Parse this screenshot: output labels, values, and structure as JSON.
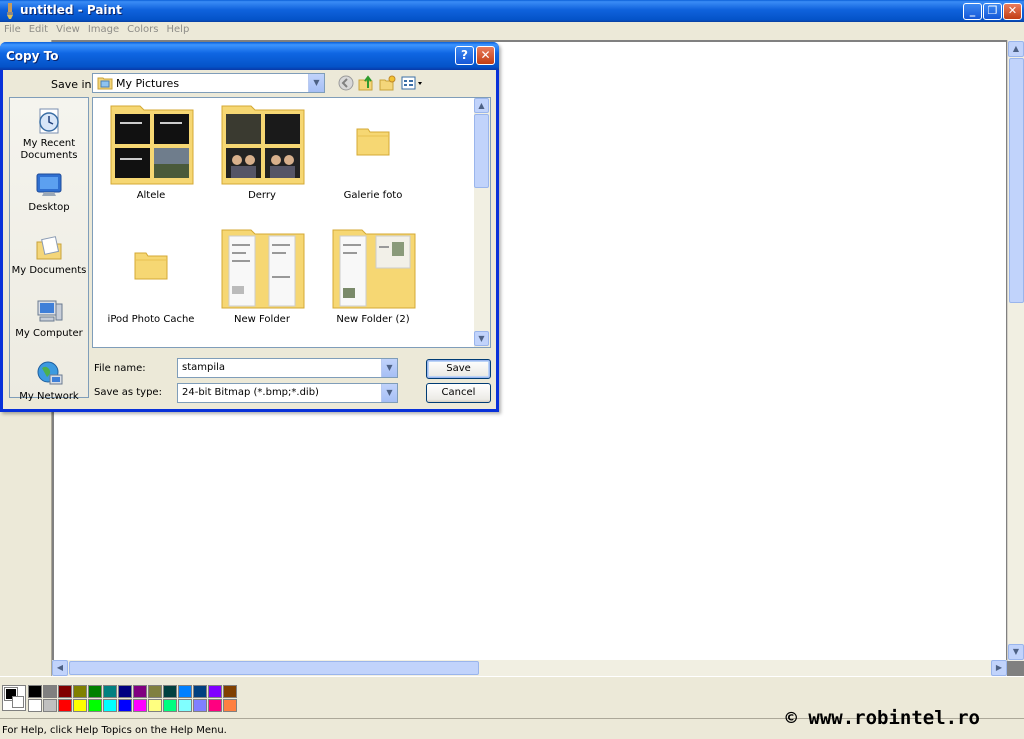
{
  "window": {
    "title": "untitled - Paint",
    "minimize": "_",
    "restore": "❐",
    "close": "✕"
  },
  "menu": [
    "File",
    "Edit",
    "View",
    "Image",
    "Colors",
    "Help"
  ],
  "dialog": {
    "title": "Copy To",
    "help_btn": "?",
    "close_btn": "✕",
    "save_in_label": "Save in:",
    "save_in_value": "My Pictures",
    "places": [
      "My Recent\nDocuments",
      "Desktop",
      "My Documents",
      "My Computer",
      "My Network"
    ],
    "items": [
      "Altele",
      "Derry",
      "Galerie foto",
      "iPod Photo Cache",
      "New Folder",
      "New Folder (2)"
    ],
    "file_name_label": "File name:",
    "file_name_value": "stampila",
    "save_type_label": "Save as type:",
    "save_type_value": "24-bit Bitmap (*.bmp;*.dib)",
    "save_button": "Save",
    "cancel_button": "Cancel"
  },
  "palette": {
    "row1": [
      "#000000",
      "#808080",
      "#800000",
      "#808000",
      "#008000",
      "#008080",
      "#000080",
      "#800080",
      "#808040",
      "#004040",
      "#0080FF",
      "#004080",
      "#8000FF",
      "#804000"
    ],
    "row2": [
      "#FFFFFF",
      "#C0C0C0",
      "#FF0000",
      "#FFFF00",
      "#00FF00",
      "#00FFFF",
      "#0000FF",
      "#FF00FF",
      "#FFFF80",
      "#00FF80",
      "#80FFFF",
      "#8080FF",
      "#FF0080",
      "#FF8040"
    ]
  },
  "status": {
    "help_text": "For Help, click Help Topics on the Help Menu.",
    "copyright": "© www.robintel.ro"
  }
}
